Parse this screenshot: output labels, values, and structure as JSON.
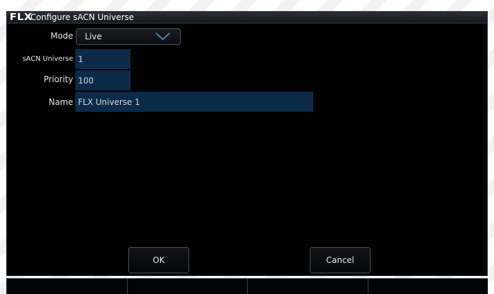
{
  "window": {
    "logo": "FLX",
    "title": "Configure sACN Universe"
  },
  "form": {
    "mode": {
      "label": "Mode",
      "value": "Live",
      "icon": "chevron-down-icon"
    },
    "universe": {
      "label": "sACN Universe",
      "value": "1"
    },
    "priority": {
      "label": "Priority",
      "value": "100"
    },
    "name": {
      "label": "Name",
      "value": "FLX Universe 1"
    }
  },
  "buttons": {
    "ok": "OK",
    "cancel": "Cancel"
  },
  "softkeys": [
    "",
    "",
    "",
    ""
  ],
  "colors": {
    "field_bg": "#0d2a48",
    "dialog_bg": "#010101",
    "accent_border": "#4c5563"
  }
}
